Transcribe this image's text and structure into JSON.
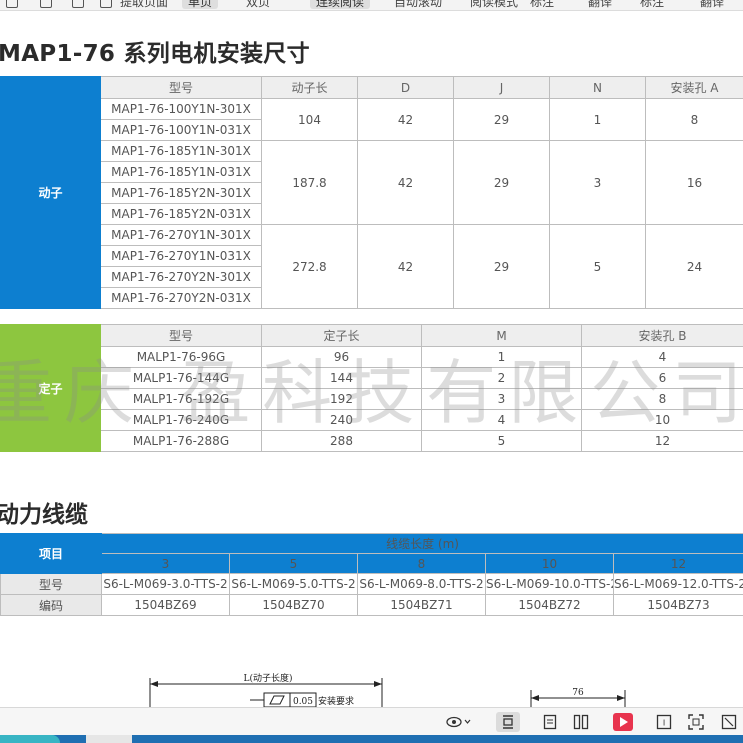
{
  "toolbar": {
    "items": [
      "提取页面",
      "单页",
      "双页",
      "阅读模式",
      "连续阅读",
      "自动滚动",
      "标注",
      "翻译"
    ],
    "active": "连续阅读"
  },
  "section1": {
    "title": "MAP1-76 系列电机安装尺寸"
  },
  "rotor_table": {
    "group_label": "动子",
    "headers": [
      "型号",
      "动子长",
      "D",
      "J",
      "N",
      "安装孔 A"
    ],
    "groups": [
      {
        "models": [
          "MAP1-76-100Y1N-301X",
          "MAP1-76-100Y1N-031X"
        ],
        "length": "104",
        "D": "42",
        "J": "29",
        "N": "1",
        "A": "8"
      },
      {
        "models": [
          "MAP1-76-185Y1N-301X",
          "MAP1-76-185Y1N-031X",
          "MAP1-76-185Y2N-301X",
          "MAP1-76-185Y2N-031X"
        ],
        "length": "187.8",
        "D": "42",
        "J": "29",
        "N": "3",
        "A": "16"
      },
      {
        "models": [
          "MAP1-76-270Y1N-301X",
          "MAP1-76-270Y1N-031X",
          "MAP1-76-270Y2N-301X",
          "MAP1-76-270Y2N-031X"
        ],
        "length": "272.8",
        "D": "42",
        "J": "29",
        "N": "5",
        "A": "24"
      }
    ]
  },
  "stator_table": {
    "group_label": "定子",
    "headers": [
      "型号",
      "定子长",
      "M",
      "安装孔 B"
    ],
    "rows": [
      [
        "MALP1-76-96G",
        "96",
        "1",
        "4"
      ],
      [
        "MALP1-76-144G",
        "144",
        "2",
        "6"
      ],
      [
        "MALP1-76-192G",
        "192",
        "3",
        "8"
      ],
      [
        "MALP1-76-240G",
        "240",
        "4",
        "10"
      ],
      [
        "MALP1-76-288G",
        "288",
        "5",
        "12"
      ]
    ]
  },
  "watermark": "重庆 盈科技有限公司",
  "section2": {
    "title": "动力线缆"
  },
  "cable_table": {
    "item_label": "项目",
    "length_label": "线缆长度 (m)",
    "lengths": [
      "3",
      "5",
      "8",
      "10",
      "12"
    ],
    "model_label": "型号",
    "models": [
      "S6-L-M069-3.0-TTS-2",
      "S6-L-M069-5.0-TTS-2",
      "S6-L-M069-8.0-TTS-2",
      "S6-L-M069-10.0-TTS-2",
      "S6-L-M069-12.0-TTS-2"
    ],
    "code_label": "编码",
    "codes": [
      "1504BZ69",
      "1504BZ70",
      "1504BZ71",
      "1504BZ72",
      "1504BZ73"
    ]
  },
  "drawing": {
    "length_label": "L(动子长度)",
    "tolerance": "0.05",
    "requirement": "安装要求",
    "dim_76": "76"
  },
  "viewer_bar": {
    "icons": [
      "eye-icon",
      "fit-width-icon",
      "single-page-icon",
      "two-page-icon",
      "play-icon",
      "ocr-icon",
      "screenshot-icon",
      "more-icon"
    ],
    "play_color": "#e8344e"
  }
}
